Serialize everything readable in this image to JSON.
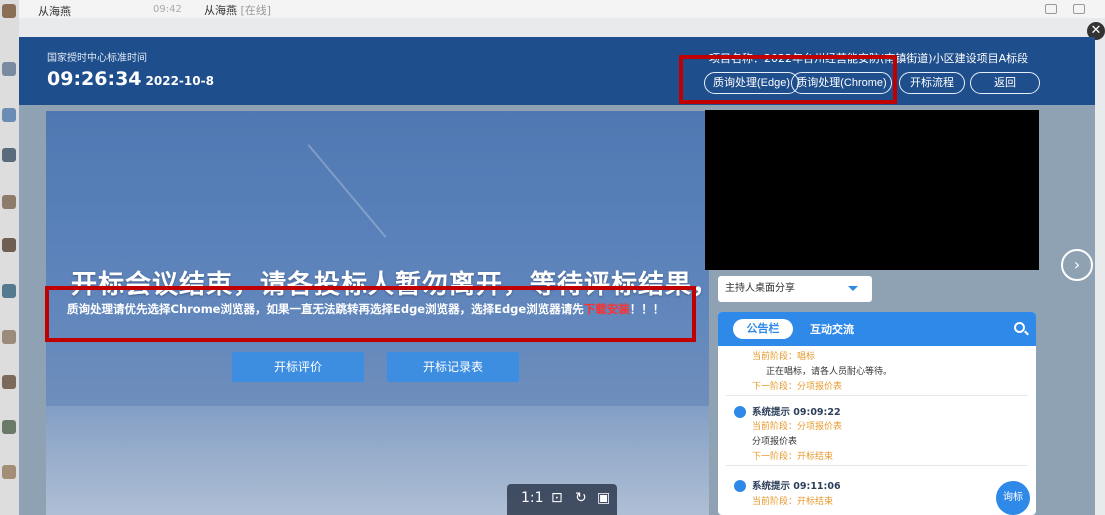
{
  "chat": {
    "contact_name": "从海燕",
    "time": "09:42",
    "title_name": "从海燕",
    "title_status": "[在线]"
  },
  "header": {
    "time_label": "国家授时中心标准时间",
    "clock": "09:26:34",
    "date": "2022-10-8",
    "project_text": "项目名称：2022年台州经营能安防(南镇街道)小区建设项目A标段",
    "buttons": {
      "edge": "质询处理(Edge)",
      "chrome": "质询处理(Chrome)",
      "flow": "开标流程",
      "back": "返回"
    }
  },
  "main": {
    "big_message": "开标会议结束，请各投标人暂勿离开，等待评标结果，谢谢！",
    "notice_before": "质询处理请优先选择Chrome浏览器，如果一直无法跳转再选择Edge浏览器，选择Edge浏览器请先",
    "notice_link": "下载安装",
    "notice_after": "！！！",
    "btn_eval": "开标评价",
    "btn_record": "开标记录表"
  },
  "toolbar": {
    "ratio": "1:1",
    "fit_icon": "fit-screen-icon",
    "rotate_icon": "rotate-icon",
    "save_icon": "save-icon"
  },
  "right": {
    "share_select": "主持人桌面分享",
    "tab_notice": "公告栏",
    "tab_chat": "互动交流",
    "feed": {
      "e0_stage": "当前阶段：唱标",
      "e0_msg": "正在唱标，请各人员耐心等待。",
      "e0_next": "下一阶段：分项报价表",
      "e1_title": "系统提示 09:09:22",
      "e1_stage": "当前阶段：分项报价表",
      "e1_msg": "分项报价表",
      "e1_next": "下一阶段：开标结束",
      "e2_title": "系统提示 09:11:06",
      "e2_stage": "当前阶段：开标结束"
    },
    "ask_button": "询标"
  },
  "colors": {
    "header_blue": "#1f4e8c",
    "accent_blue": "#2f89e8",
    "highlight_red": "#c00000",
    "link_red": "#ff3030",
    "stage_orange": "#e69a2e"
  }
}
